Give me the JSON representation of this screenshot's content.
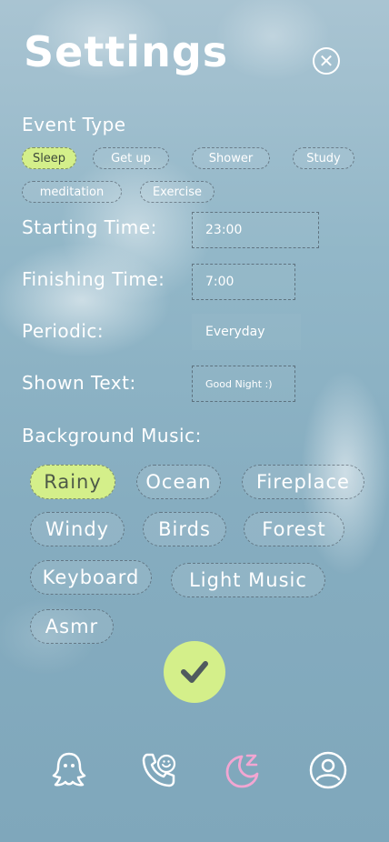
{
  "header": {
    "title": "Settings",
    "close_icon": "close-icon"
  },
  "event_type": {
    "label": "Event Type",
    "options": [
      "Sleep",
      "Get up",
      "Shower",
      "Study",
      "meditation",
      "Exercise"
    ],
    "selected": "Sleep"
  },
  "starting_time": {
    "label": "Starting Time:",
    "value": "23:00"
  },
  "finishing_time": {
    "label": "Finishing Time:",
    "value": "7:00"
  },
  "periodic": {
    "label": "Periodic:",
    "value": "Everyday"
  },
  "shown_text": {
    "label": "Shown Text:",
    "value": "Good Night :)"
  },
  "background_music": {
    "label": "Background Music:",
    "options": [
      "Rainy",
      "Ocean",
      "Fireplace",
      "Windy",
      "Birds",
      "Forest",
      "Keyboard",
      "Light Music",
      "Asmr"
    ],
    "selected": "Rainy"
  },
  "confirm": {
    "icon": "checkmark-icon"
  },
  "bottom_nav": {
    "items": [
      "ghost-icon",
      "phone-icon",
      "moon-sleep-icon",
      "profile-icon"
    ],
    "active": "moon-sleep-icon",
    "active_color": "#f2a6d2"
  },
  "colors": {
    "accent": "#d4ef8a"
  }
}
